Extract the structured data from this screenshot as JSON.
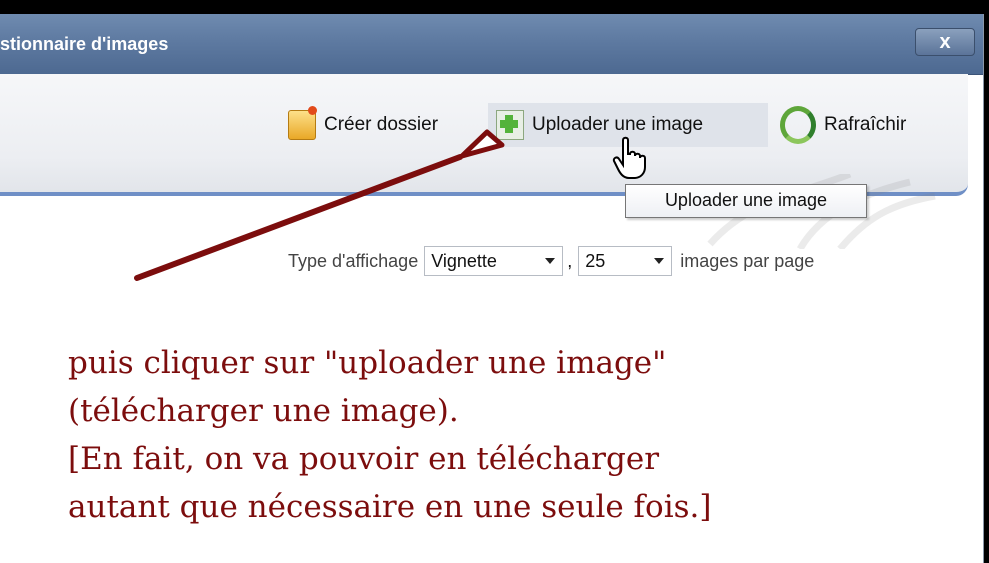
{
  "window": {
    "title": "stionnaire d'images",
    "close_label": "x"
  },
  "toolbar": {
    "create_folder": "Créer dossier",
    "upload_image": "Uploader une image",
    "refresh": "Rafraîchir"
  },
  "tooltip": "Uploader une image",
  "display": {
    "type_label": "Type d'affichage",
    "view_value": "Vignette",
    "separator": ",",
    "count_value": "25",
    "per_page_label": "images par page"
  },
  "annotation": {
    "line1": "puis cliquer sur \"uploader une image\"",
    "line2": "(télécharger une image).",
    "line3": "[En fait, on va pouvoir en télécharger",
    "line4": "autant que nécessaire en une seule fois.]"
  },
  "colors": {
    "annotation": "#7c0d0d",
    "titlebar": "#5e7aa1",
    "toolbar_border": "#6f8fc6"
  }
}
